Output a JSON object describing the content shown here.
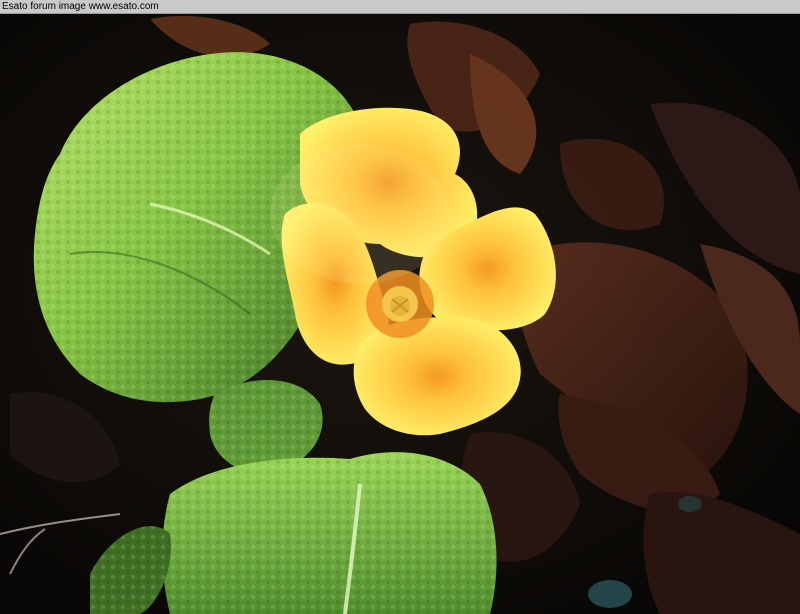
{
  "watermark": {
    "text": "Esato forum image www.esato.com"
  },
  "photo": {
    "subject": "yellow-primrose-flower",
    "colors": {
      "petal": "#ffe447",
      "petal_center": "#f4a42a",
      "leaf_light": "#9ed24c",
      "leaf_dark": "#2f5a1e",
      "dead_leaf": "#4a2418",
      "background": "#0b0a08"
    }
  }
}
